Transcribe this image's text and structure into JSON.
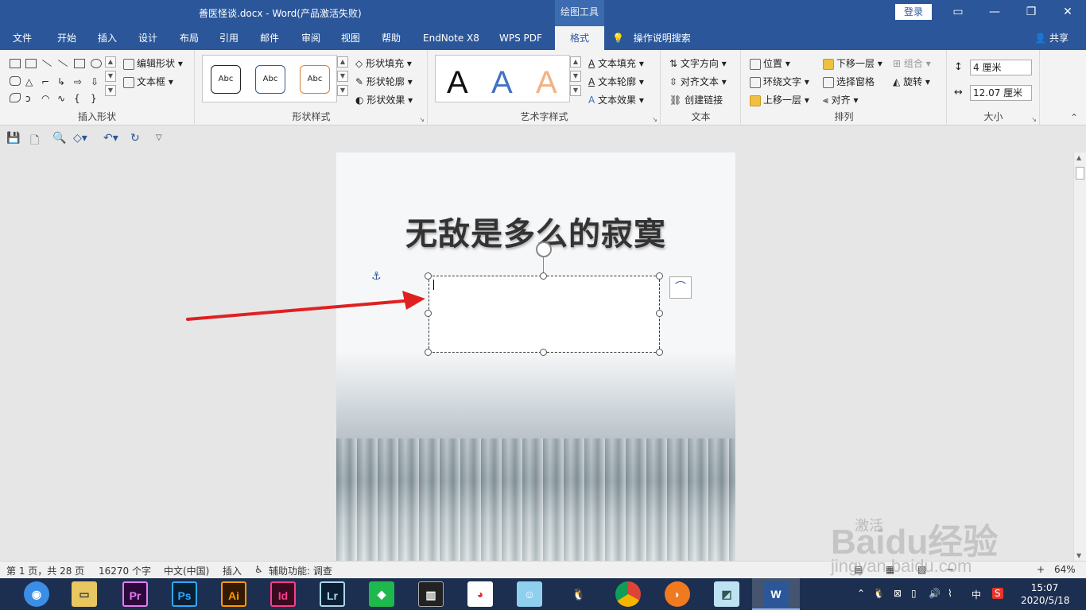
{
  "titlebar": {
    "doc_title": "善医怪谈.docx  -  Word(产品激活失败)",
    "context_title": "绘图工具",
    "login_label": "登录",
    "min_icon": "minimize-icon",
    "restore_icon": "restore-icon",
    "close_icon": "close-icon"
  },
  "tabs": {
    "items": [
      "文件",
      "开始",
      "插入",
      "设计",
      "布局",
      "引用",
      "邮件",
      "审阅",
      "视图",
      "帮助",
      "EndNote X8",
      "WPS PDF",
      "格式"
    ],
    "active": "格式",
    "tell_me": "操作说明搜索",
    "share": "共享"
  },
  "ribbon": {
    "insert_shapes": {
      "label": "插入形状",
      "edit_shape": "编辑形状",
      "text_box": "文本框"
    },
    "shape_styles": {
      "label": "形状样式",
      "sample": "Abc",
      "fill": "形状填充",
      "outline": "形状轮廓",
      "effects": "形状效果"
    },
    "wordart": {
      "label": "艺术字样式",
      "letter": "A",
      "text_fill": "文本填充",
      "text_outline": "文本轮廓",
      "text_effects": "文本效果"
    },
    "text": {
      "label": "文本",
      "direction": "文字方向",
      "align": "对齐文本",
      "link": "创建链接"
    },
    "arrange": {
      "label": "排列",
      "position": "位置",
      "wrap": "环绕文字",
      "bring_forward": "上移一层",
      "send_backward": "下移一层",
      "selection_pane": "选择窗格",
      "align": "对齐",
      "group": "组合",
      "rotate": "旋转"
    },
    "size": {
      "label": "大小",
      "height": "4 厘米",
      "width": "12.07 厘米"
    }
  },
  "document": {
    "heading": "无敌是多么的寂寞"
  },
  "statusbar": {
    "page": "第 1 页，共 28 页",
    "words": "16270 个字",
    "language": "中文(中国)",
    "mode": "插入",
    "accessibility": "辅助功能: 调查",
    "zoom": "64%"
  },
  "watermark": {
    "activate": "激活",
    "brand": "Baidu经验",
    "url": "jingyan.baidu.com"
  },
  "taskbar": {
    "apps": [
      "Pr",
      "Ps",
      "Ai",
      "Id",
      "Lr",
      "W"
    ],
    "tray_ime": "中",
    "time": "15:07",
    "date": "2020/5/18"
  },
  "colors": {
    "accent": "#2b579a",
    "arrow": "#e02020"
  }
}
